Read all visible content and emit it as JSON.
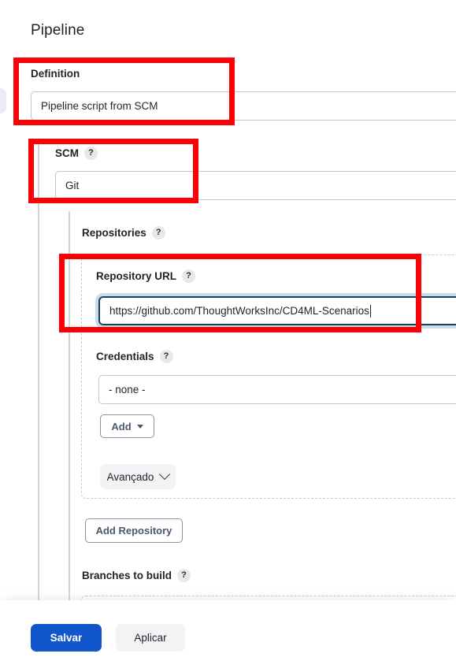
{
  "page": {
    "title": "Pipeline"
  },
  "definition": {
    "label": "Definition",
    "value": "Pipeline script from SCM"
  },
  "scm": {
    "label": "SCM",
    "help_icon": "help-question-icon",
    "help_glyph": "?",
    "value": "Git"
  },
  "repositories": {
    "label": "Repositories",
    "help_glyph": "?",
    "repository_url": {
      "label": "Repository URL",
      "help_glyph": "?",
      "value": "https://github.com/ThoughtWorksInc/CD4ML-Scenarios",
      "focused": true
    },
    "credentials": {
      "label": "Credentials",
      "help_glyph": "?",
      "value": "- none -"
    },
    "add_button": {
      "label": "Add",
      "caret_icon": "caret-down-icon"
    },
    "advanced_button": {
      "label": "Avançado",
      "chevron_icon": "chevron-down-icon"
    },
    "add_repository_button": {
      "label": "Add Repository"
    }
  },
  "branches": {
    "label": "Branches to build",
    "help_glyph": "?"
  },
  "footer": {
    "save_label": "Salvar",
    "apply_label": "Aplicar"
  },
  "annotations": {
    "definition_box": "highlight-definition",
    "scm_box": "highlight-scm",
    "repository_url_box": "highlight-repository-url",
    "color": "#fb0007"
  }
}
